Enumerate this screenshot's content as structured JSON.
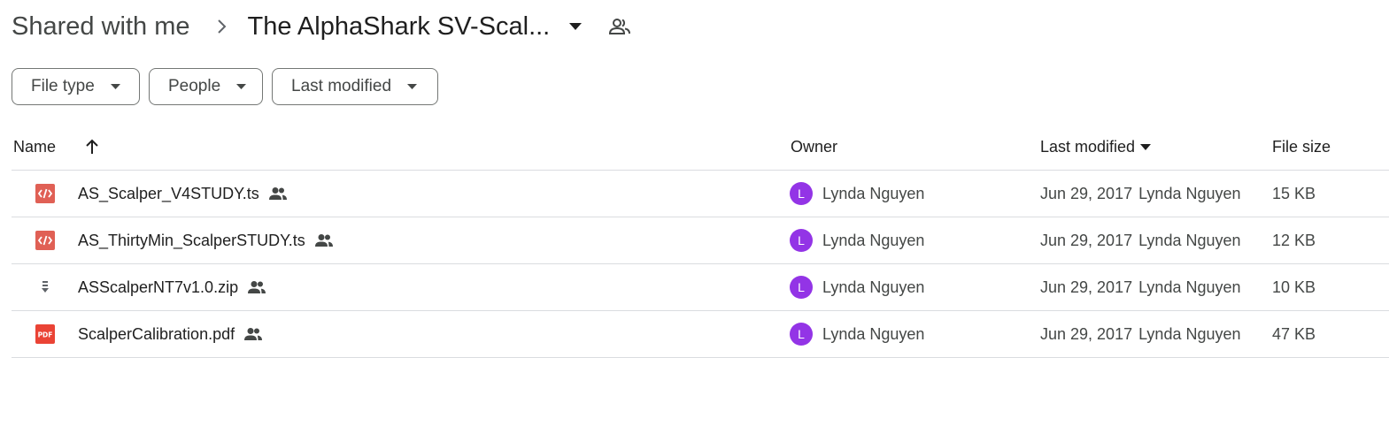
{
  "breadcrumb": {
    "parent": "Shared with me",
    "current": "The AlphaShark SV-Scal..."
  },
  "filters": [
    {
      "label": "File type"
    },
    {
      "label": "People"
    },
    {
      "label": "Last modified"
    }
  ],
  "table": {
    "headers": {
      "name": "Name",
      "owner": "Owner",
      "last_modified": "Last modified",
      "file_size": "File size"
    },
    "rows": [
      {
        "icon": "code-file-icon",
        "name": "AS_Scalper_V4STUDY.ts",
        "owner_initial": "L",
        "owner": "Lynda Nguyen",
        "date": "Jun 29, 2017",
        "modified_by": "Lynda Nguyen",
        "size": "15 KB"
      },
      {
        "icon": "code-file-icon",
        "name": "AS_ThirtyMin_ScalperSTUDY.ts",
        "owner_initial": "L",
        "owner": "Lynda Nguyen",
        "date": "Jun 29, 2017",
        "modified_by": "Lynda Nguyen",
        "size": "12 KB"
      },
      {
        "icon": "zip-file-icon",
        "name": "ASScalperNT7v1.0.zip",
        "owner_initial": "L",
        "owner": "Lynda Nguyen",
        "date": "Jun 29, 2017",
        "modified_by": "Lynda Nguyen",
        "size": "10 KB"
      },
      {
        "icon": "pdf-file-icon",
        "name": "ScalperCalibration.pdf",
        "owner_initial": "L",
        "owner": "Lynda Nguyen",
        "date": "Jun 29, 2017",
        "modified_by": "Lynda Nguyen",
        "size": "47 KB",
        "icon_text": "PDF"
      }
    ]
  },
  "colors": {
    "code_icon": "#e06055",
    "pdf_icon": "#ea4335",
    "zip_icon": "#5f6368",
    "avatar": "#9334e6",
    "divider": "#dadce0"
  }
}
